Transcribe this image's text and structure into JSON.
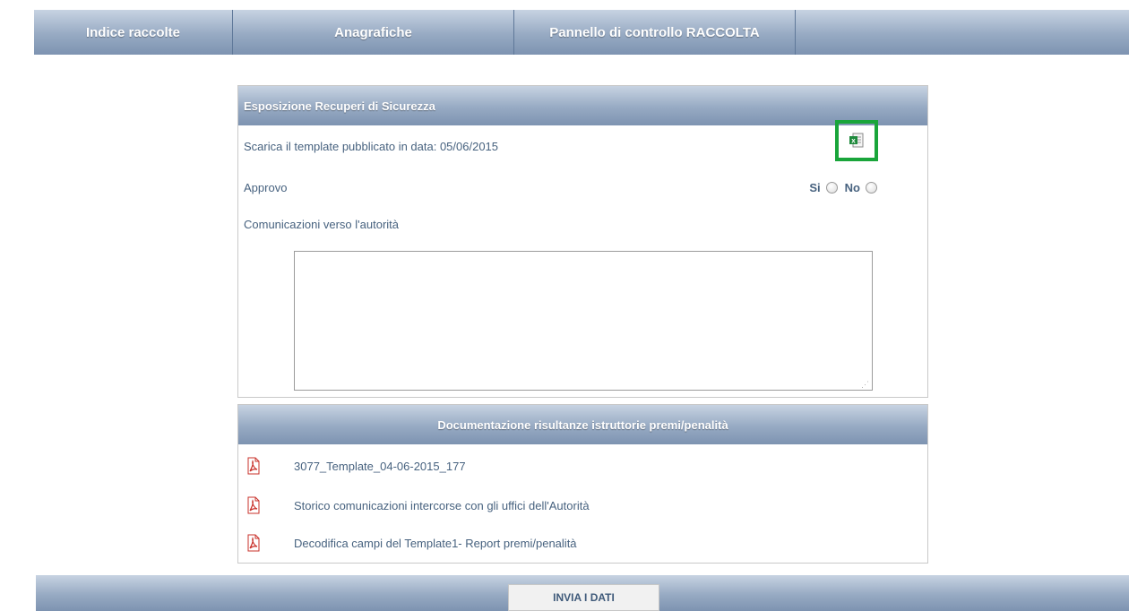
{
  "nav": {
    "tabs": [
      {
        "label": "Indice raccolte"
      },
      {
        "label": "Anagrafiche"
      },
      {
        "label": "Pannello di controllo RACCOLTA"
      }
    ]
  },
  "panel1": {
    "title": "Esposizione Recuperi di Sicurezza",
    "download_label": "Scarica il template pubblicato in data: 05/06/2015",
    "download_icon": "excel-file-icon",
    "approve_label": "Approvo",
    "options": [
      "Si",
      "No"
    ],
    "communications_label": "Comunicazioni verso l'autorità",
    "communications_value": ""
  },
  "panel2": {
    "title": "Documentazione risultanze istruttorie premi/penalità",
    "documents": [
      {
        "name": "3077_Template_04-06-2015_177",
        "icon": "pdf-icon"
      },
      {
        "name": "Storico comunicazioni intercorse con gli uffici dell'Autorità",
        "icon": "pdf-icon"
      },
      {
        "name": "Decodifica campi del Template1- Report premi/penalità",
        "icon": "pdf-icon"
      }
    ]
  },
  "footer": {
    "send_label": "INVIA I DATI"
  },
  "colors": {
    "header_gradient_top": "#c7d3e2",
    "header_gradient_bottom": "#7d93b1",
    "highlight": "#19a53a",
    "text": "#47627f"
  }
}
